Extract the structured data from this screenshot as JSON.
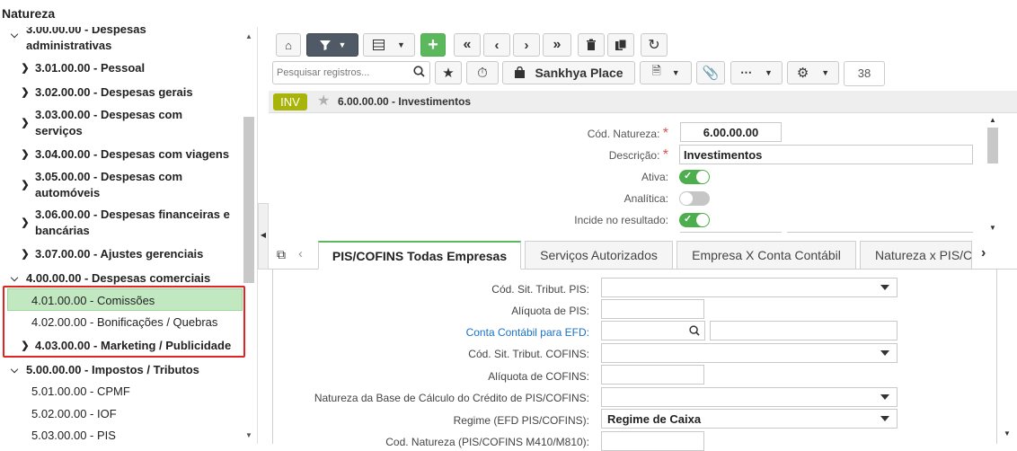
{
  "window": {
    "title": "Natureza"
  },
  "tree": {
    "items": [
      {
        "label": "3.00.00.00 - Despesas administrativas",
        "level": 0,
        "expanded": true,
        "bold": true
      },
      {
        "label": "3.01.00.00 - Pessoal",
        "level": 1,
        "expandable": true,
        "bold": true
      },
      {
        "label": "3.02.00.00 - Despesas gerais",
        "level": 1,
        "expandable": true,
        "bold": true
      },
      {
        "label": "3.03.00.00 - Despesas com serviços",
        "level": 1,
        "expandable": true,
        "bold": true
      },
      {
        "label": "3.04.00.00 - Despesas com viagens",
        "level": 1,
        "expandable": true,
        "bold": true
      },
      {
        "label": "3.05.00.00 - Despesas com automóveis",
        "level": 1,
        "expandable": true,
        "bold": true
      },
      {
        "label": "3.06.00.00 - Despesas financeiras e bancárias",
        "level": 1,
        "expandable": true,
        "bold": true
      },
      {
        "label": "3.07.00.00 - Ajustes gerenciais",
        "level": 1,
        "expandable": true,
        "bold": true
      },
      {
        "label": "4.00.00.00 - Despesas comerciais",
        "level": 0,
        "expanded": true,
        "bold": true
      },
      {
        "label": "4.01.00.00 - Comissões",
        "level": 1,
        "selected": true
      },
      {
        "label": "4.02.00.00 - Bonificações / Quebras",
        "level": 1
      },
      {
        "label": "4.03.00.00 - Marketing / Publicidade",
        "level": 1,
        "expandable": true,
        "bold": true
      },
      {
        "label": "5.00.00.00 - Impostos / Tributos",
        "level": 0,
        "expanded": true,
        "bold": true
      },
      {
        "label": "5.01.00.00 - CPMF",
        "level": 1
      },
      {
        "label": "5.02.00.00 - IOF",
        "level": 1
      },
      {
        "label": "5.03.00.00 - PIS",
        "level": 1
      }
    ]
  },
  "toolbar": {
    "search_placeholder": "Pesquisar registros...",
    "place_label": "Sankhya Place",
    "record_count": "38"
  },
  "record": {
    "badge": "INV",
    "title": "6.00.00.00 - Investimentos"
  },
  "form": {
    "cod_label": "Cód. Natureza:",
    "cod_value": "6.00.00.00",
    "desc_label": "Descrição:",
    "desc_value": "Investimentos",
    "ativa_label": "Ativa:",
    "ativa": true,
    "analitica_label": "Analítica:",
    "analitica": false,
    "incide_label": "Incide no resultado:",
    "incide": true
  },
  "tabs": [
    {
      "label": "PIS/COFINS Todas Empresas",
      "active": true
    },
    {
      "label": "Serviços Autorizados"
    },
    {
      "label": "Empresa X Conta Contábil"
    },
    {
      "label": "Natureza x PIS/C"
    }
  ],
  "detail": {
    "fields": [
      {
        "label": "Cód. Sit. Tribut. PIS:",
        "type": "select",
        "value": ""
      },
      {
        "label": "Alíquota de PIS:",
        "type": "text",
        "value": ""
      },
      {
        "label": "Conta Contábil para EFD:",
        "type": "lookup",
        "value": ""
      },
      {
        "label": "Cód. Sit. Tribut. COFINS:",
        "type": "select",
        "value": ""
      },
      {
        "label": "Alíquota de COFINS:",
        "type": "text",
        "value": ""
      },
      {
        "label": "Natureza da Base de Cálculo do Crédito de PIS/COFINS:",
        "type": "select",
        "value": ""
      },
      {
        "label": "Regime (EFD PIS/COFINS):",
        "type": "select",
        "value": "Regime de Caixa"
      },
      {
        "label": "Cod. Natureza (PIS/COFINS M410/M810):",
        "type": "text",
        "value": ""
      }
    ]
  },
  "colors": {
    "accent_green": "#5cb85c",
    "selection_bg": "#c2e8c2",
    "highlight_red": "#e02424",
    "badge_olive": "#a9b40a"
  }
}
